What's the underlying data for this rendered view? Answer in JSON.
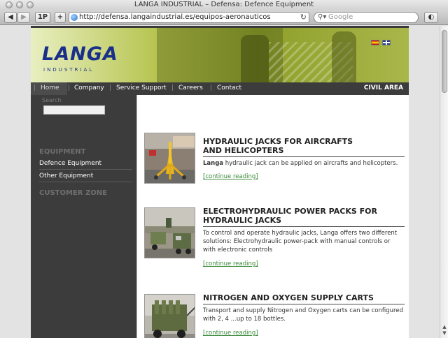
{
  "window": {
    "title": "LANGA INDUSTRIAL – Defensa: Defence Equipment"
  },
  "toolbar": {
    "back_icon": "back-arrow",
    "forward_icon": "forward-arrow",
    "onepassword_label": "1P",
    "add_label": "+",
    "url": "http://defensa.langaindustrial.es/equipos-aeronauticos",
    "reload_icon": "reload-icon",
    "search_placeholder": "Google"
  },
  "site": {
    "logo_text": "LANGA",
    "logo_sub": "INDUSTRIAL",
    "nav": {
      "items": [
        "Home",
        "Company",
        "Service Support",
        "Careers",
        "Contact"
      ],
      "civil_area": "CIVIL AREA"
    },
    "sidebar": {
      "search_label": "Search",
      "equipment_heading": "EQUIPMENT",
      "items": [
        "Defence Equipment",
        "Other Equipment"
      ],
      "customer_zone": "CUSTOMER ZONE"
    },
    "articles": [
      {
        "title_line1": "HYDRAULIC JACKS FOR AIRCRAFTS",
        "title_line2": "AND HELICOPTERS",
        "body_bold": "Langa",
        "body": " hydraulic jack can be applied on aircrafts and helicopters.",
        "link": "[continue reading]"
      },
      {
        "title_line1": "ELECTROHYDRAULIC POWER PACKS FOR",
        "title_line2": "HYDRAULIC JACKS",
        "body": "To control and operate hydraulic jacks, Langa offers two different solutions: Electrohydraulic power-pack with manual controls or with electronic controls",
        "link": "[continue reading]"
      },
      {
        "title_line1": "NITROGEN AND OXYGEN SUPPLY CARTS",
        "body": "Transport and supply Nitrogen and Oxygen carts can be configured with 2, 4 ...up to 18 bottles.",
        "link": "[continue reading]"
      }
    ]
  }
}
